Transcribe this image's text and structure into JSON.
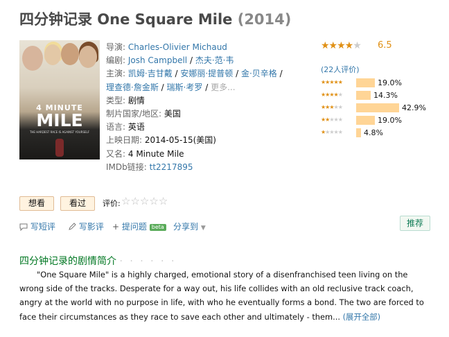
{
  "movie": {
    "title": "四分钟记录 One Square Mile",
    "year": "(2014)"
  },
  "poster": {
    "line1": "4 MINUTE",
    "line2": "MILE",
    "tagline": "THE HARDEST RACE IS AGAINST YOURSELF"
  },
  "info": {
    "director_label": "导演:",
    "director": "Charles-Olivier Michaud",
    "writer_label": "编剧:",
    "writers": [
      "Josh Campbell",
      "杰夫·范·韦"
    ],
    "cast_label": "主演:",
    "cast": [
      "凯姆·吉甘戴",
      "安娜丽·提普顿",
      "金·贝辛格",
      "理查德·詹金斯",
      "瑞斯·考罗"
    ],
    "more": "更多...",
    "genre_label": "类型:",
    "genre": "剧情",
    "country_label": "制片国家/地区:",
    "country": "美国",
    "language_label": "语言:",
    "language": "英语",
    "release_label": "上映日期:",
    "release": "2014-05-15(美国)",
    "aka_label": "又名:",
    "aka": "4 Minute Mile",
    "imdb_label": "IMDb链接:",
    "imdb": "tt2217895"
  },
  "rating": {
    "score": "6.5",
    "count_text": "(22人评价)",
    "accent_color": "#e09015",
    "bar_color": "#ffd596",
    "distribution": [
      {
        "stars": 5,
        "percent": 19.0,
        "label": "19.0%"
      },
      {
        "stars": 4,
        "percent": 14.3,
        "label": "14.3%"
      },
      {
        "stars": 3,
        "percent": 42.9,
        "label": "42.9%"
      },
      {
        "stars": 2,
        "percent": 19.0,
        "label": "19.0%"
      },
      {
        "stars": 1,
        "percent": 4.8,
        "label": "4.8%"
      }
    ]
  },
  "buttons": {
    "want": "想看",
    "seen": "看过",
    "rate_label": "评价:"
  },
  "actions": {
    "short_review": "写短评",
    "review": "写影评",
    "ask": "提问题",
    "beta": "beta",
    "share": "分享到",
    "recommend": "推荐"
  },
  "synopsis": {
    "title": "四分钟记录的剧情简介",
    "dots": "· · · · · ·",
    "text": "\"One Square Mile\" is a highly charged, emotional story of a disenfranchised teen living on the wrong side of the tracks. Desperate for a way out, his life collides with an old reclusive track coach, angry at the world with no purpose in life, with who he eventually forms a bond. The two are forced to face their circumstances as they race to save each other and ultimately - them...",
    "expand": "(展开全部)"
  }
}
